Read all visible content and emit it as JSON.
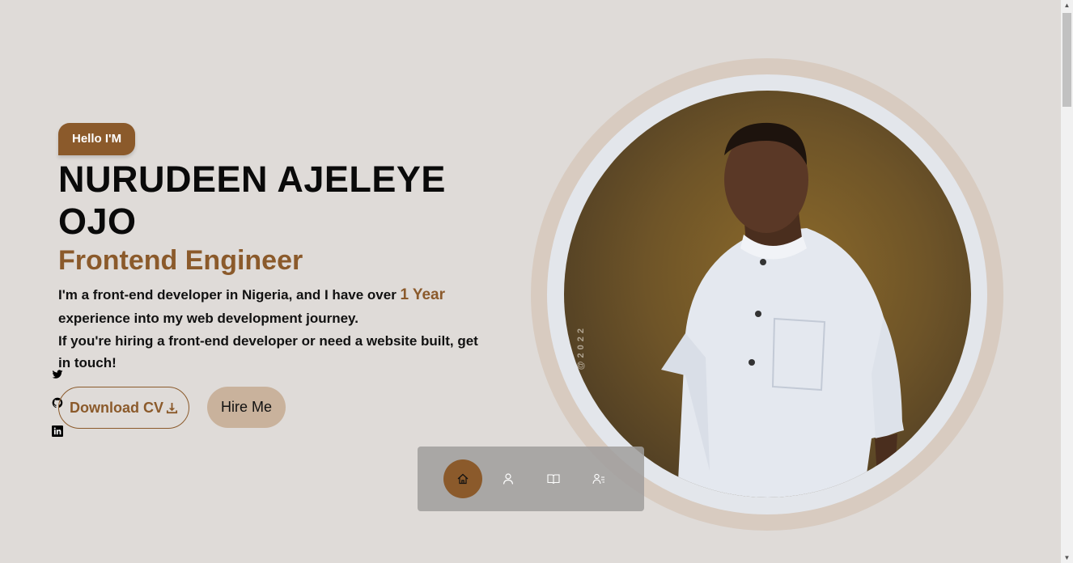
{
  "hero": {
    "greeting": "Hello I'M",
    "name": "NURUDEEN AJELEYE OJO",
    "role": "Frontend Engineer",
    "bio_part1": "I'm a front-end developer in Nigeria, and I have over",
    "bio_highlight_num": "1",
    "bio_highlight_unit": "Year",
    "bio_part2": "experience into my web development journey.",
    "bio_line2": "If you're hiring a front-end developer or need a website built, get in touch!"
  },
  "buttons": {
    "download_cv": "Download CV",
    "hire_me": "Hire Me"
  },
  "socials": [
    "twitter-icon",
    "github-icon",
    "linkedin-icon"
  ],
  "photo": {
    "watermark": "@2022"
  },
  "nav": {
    "items": [
      "home-icon",
      "user-icon",
      "book-icon",
      "contact-list-icon"
    ],
    "active": "home-icon"
  },
  "colors": {
    "background": "#dfdbd8",
    "accent": "#8b5a2b",
    "hire_button": "#c9b29c",
    "ring_outer": "#d8cbc0",
    "ring_inner": "#e3e6eb"
  }
}
